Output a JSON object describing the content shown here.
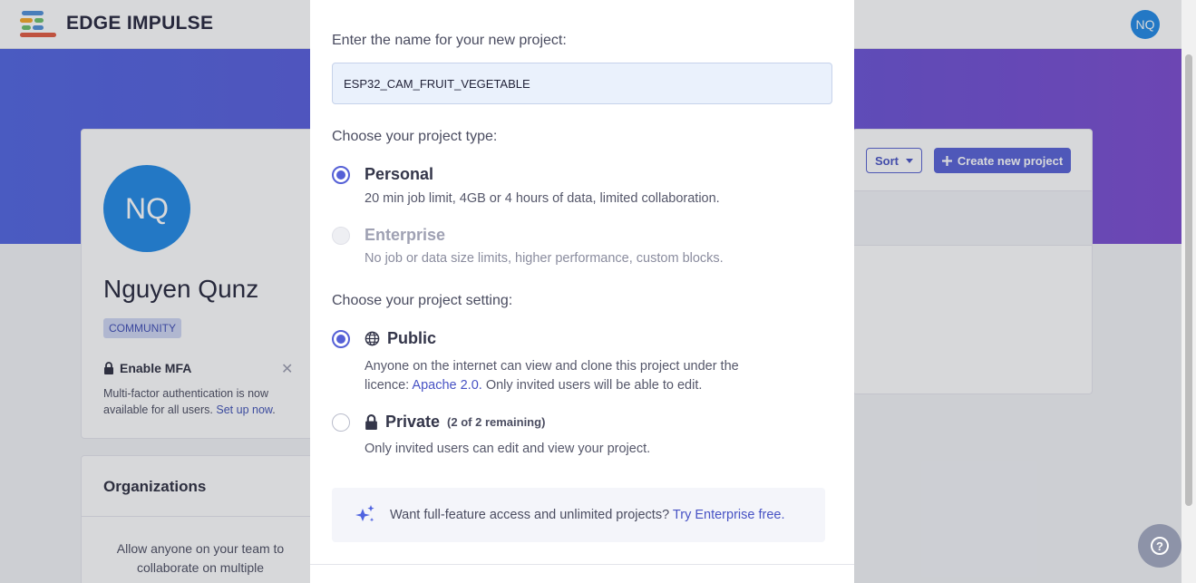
{
  "brand": {
    "name": "EDGE IMPULSE"
  },
  "user": {
    "initials": "NQ",
    "name": "Nguyen Qunz",
    "badge": "COMMUNITY"
  },
  "mfa": {
    "title": "Enable MFA",
    "text": "Multi-factor authentication is now available for all users.",
    "link": "Set up now",
    "link_suffix": "."
  },
  "organizations": {
    "title": "Organizations",
    "text": "Allow anyone on your team to collaborate on multiple"
  },
  "projects": {
    "sort_label": "Sort",
    "create_label": "Create new project"
  },
  "modal": {
    "name_label": "Enter the name for your new project:",
    "name_value": "ESP32_CAM_FRUIT_VEGETABLE",
    "type_label": "Choose your project type:",
    "types": [
      {
        "title": "Personal",
        "desc": "20 min job limit, 4GB or 4 hours of data, limited collaboration.",
        "selected": true,
        "disabled": false
      },
      {
        "title": "Enterprise",
        "desc": "No job or data size limits, higher performance, custom blocks.",
        "selected": false,
        "disabled": true
      }
    ],
    "setting_label": "Choose your project setting:",
    "settings": {
      "public": {
        "title": "Public",
        "desc_line1": "Anyone on the internet can view and clone this project under the",
        "desc_pre": "licence: ",
        "desc_link": "Apache 2.0.",
        "desc_post": " Only invited users will be able to edit.",
        "selected": true
      },
      "private": {
        "title": "Private",
        "note": "(2 of 2 remaining)",
        "desc": "Only invited users can edit and view your project.",
        "selected": false
      }
    },
    "promo": {
      "text": "Want full-feature access and unlimited projects?",
      "link": "Try Enterprise free."
    }
  },
  "help": {
    "label": "?"
  },
  "colors": {
    "accent": "#5560d6",
    "avatar": "#1e88e5",
    "hero_start": "#4f63e0",
    "hero_end": "#7a49cf"
  },
  "icons": [
    "logo-icon",
    "lock-icon",
    "close-icon",
    "plus-icon",
    "caret-down-icon",
    "globe-icon",
    "sparkle-icon",
    "help-icon"
  ]
}
